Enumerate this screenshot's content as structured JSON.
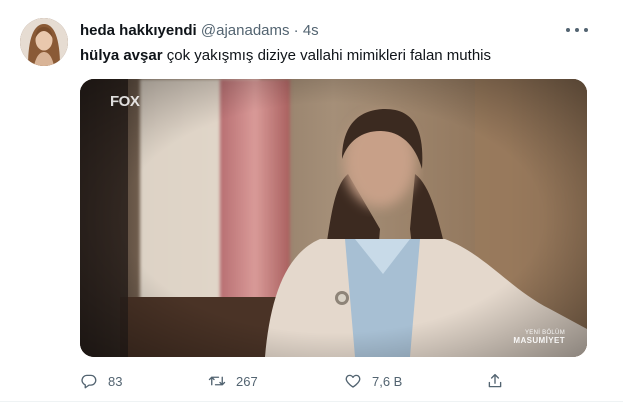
{
  "tweet": {
    "author": {
      "display_name": "heda hakkıyendi",
      "handle": "@ajanadams",
      "separator": "·",
      "time": "4s"
    },
    "text": {
      "mention": "hülya avşar",
      "body": " çok yakışmış diziye vallahi mimikleri falan muthis"
    },
    "media": {
      "channel_logo": "FOX",
      "caption_line1": "YENİ BÖLÜM",
      "caption_line2": "MASUMİYET"
    },
    "actions": {
      "replies": "83",
      "retweets": "267",
      "likes": "7,6 B"
    }
  },
  "icons": {
    "more": "more-horizontal-icon",
    "reply": "reply-icon",
    "retweet": "retweet-icon",
    "like": "heart-icon",
    "share": "share-icon"
  },
  "colors": {
    "text_primary": "#0f1419",
    "text_secondary": "#536471",
    "divider": "#eff3f4"
  }
}
